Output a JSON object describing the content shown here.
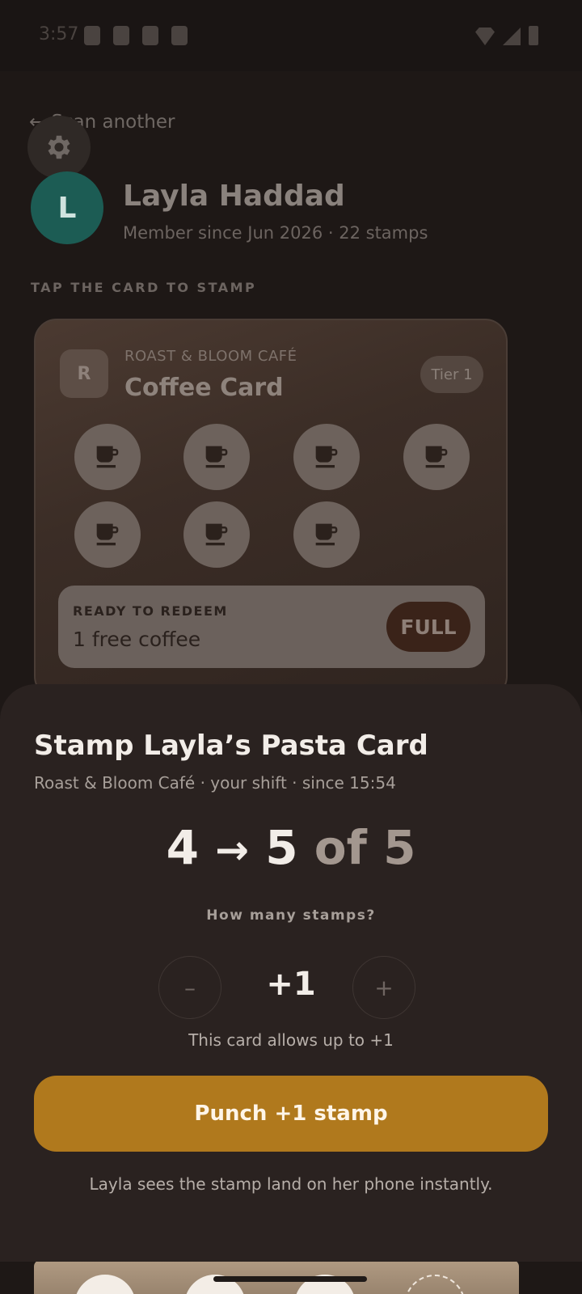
{
  "status_bar": {
    "time": "3:57"
  },
  "background": {
    "back_label": "Scan another",
    "member": {
      "initial": "L",
      "name": "Layla Haddad",
      "meta": "Member since Jun 2026 · 22 stamps"
    },
    "section_label": "TAP THE CARD TO STAMP",
    "card": {
      "logo_letter": "R",
      "brand": "ROAST & BLOOM CAFÉ",
      "title": "Coffee Card",
      "tier": "Tier 1",
      "stamps_filled": 7,
      "redeem_kicker": "READY TO REDEEM",
      "redeem_text": "1 free coffee",
      "status_pill": "FULL"
    }
  },
  "sheet": {
    "title": "Stamp Layla’s Pasta Card",
    "subtitle": "Roast & Bloom Café · your shift · since 15:54",
    "progress": {
      "from": "4",
      "arrow": "→",
      "to": "5",
      "of_label": "of 5"
    },
    "how_many_label": "How many stamps?",
    "minus_label": "–",
    "plus_label": "+",
    "stepper_value": "+1",
    "limit_note": "This card allows up to +1",
    "punch_button_label": "Punch +1 stamp",
    "footnote": "Layla sees the stamp land on her phone instantly."
  },
  "colors": {
    "accent": "#b0791d",
    "sheet_bg": "#2a2220",
    "avatar": "#1c5c54"
  }
}
